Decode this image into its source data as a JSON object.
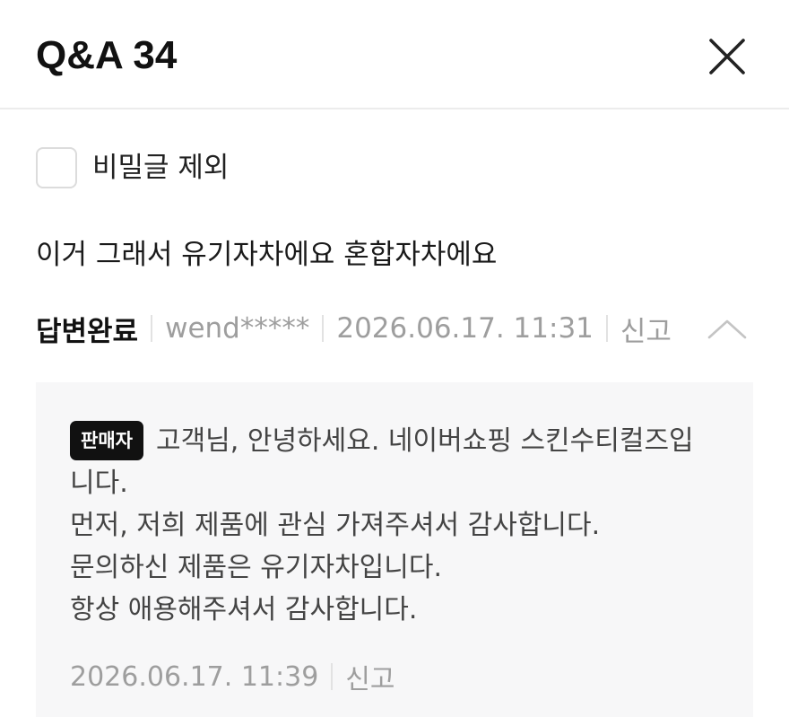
{
  "header": {
    "title": "Q&A 34",
    "close_icon": "close-icon"
  },
  "filter": {
    "label": "비밀글 제외",
    "checked": false
  },
  "question": {
    "text": "이거 그래서 유기자차에요 혼합자차에요",
    "status": "답변완료",
    "author": "wend*****",
    "datetime": "2026.06.17. 11:31",
    "report_label": "신고",
    "toggle_icon": "chevron-up-icon"
  },
  "answer": {
    "badge": "판매자",
    "text": "고객님, 안녕하세요. 네이버쇼핑 스킨수티컬즈입니다.\n먼저, 저희 제품에 관심 가져주셔서 감사합니다.\n문의하신 제품은 유기자차입니다.\n항상 애용해주셔서 감사합니다.",
    "datetime": "2026.06.17. 11:39",
    "report_label": "신고"
  },
  "colors": {
    "answer_background": "#f7f7f8",
    "badge_background": "#111111",
    "muted_text": "#9e9e9e"
  }
}
